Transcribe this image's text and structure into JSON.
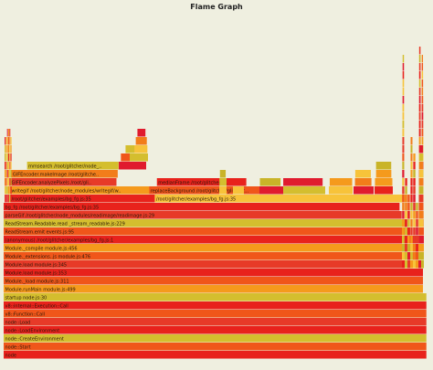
{
  "title": "Flame Graph",
  "colors": {
    "background": "#efefe0",
    "palette": [
      "#e8221c",
      "#f0561a",
      "#f59a1c",
      "#f7c33a",
      "#d4be2e",
      "#e73a28",
      "#c9b428",
      "#f27d1a",
      "#e01b2e"
    ]
  },
  "chart_data": {
    "type": "flame",
    "title": "Flame Graph",
    "frames": [
      {
        "name": "node",
        "depth": 0,
        "start": 0.0,
        "width": 99.3,
        "c": 0
      },
      {
        "name": "node::Start",
        "depth": 1,
        "start": 0.0,
        "width": 99.3,
        "c": 1
      },
      {
        "name": "node::CreateEnvironment",
        "depth": 2,
        "start": 0.0,
        "width": 99.3,
        "c": 4
      },
      {
        "name": "node::LoadEnvironment",
        "depth": 3,
        "start": 0.0,
        "width": 99.3,
        "c": 0
      },
      {
        "name": "node::Load",
        "depth": 4,
        "start": 0.0,
        "width": 99.3,
        "c": 5
      },
      {
        "name": "v8::Function::Call",
        "depth": 5,
        "start": 0.0,
        "width": 99.3,
        "c": 1
      },
      {
        "name": "v8::internal::Execution::Call",
        "depth": 6,
        "start": 0.0,
        "width": 99.3,
        "c": 0
      },
      {
        "name": "startup node.js:30",
        "depth": 7,
        "start": 0.0,
        "width": 99.3,
        "c": 4
      },
      {
        "name": "Module.runMain module.js:499",
        "depth": 8,
        "start": 0.0,
        "width": 98.5,
        "c": 2
      },
      {
        "name": "Module._load module.js:311",
        "depth": 9,
        "start": 0.0,
        "width": 98.5,
        "c": 1
      },
      {
        "name": "Module.load module.js:353",
        "depth": 10,
        "start": 0.0,
        "width": 98.5,
        "c": 0
      },
      {
        "name": "Module.load module.js:345",
        "depth": 11,
        "start": 0.0,
        "width": 98.5,
        "c": 5
      },
      {
        "name": "Module._extensions..js module.js:476",
        "depth": 12,
        "start": 0.0,
        "width": 98.5,
        "c": 1
      },
      {
        "name": "Module._compile module.js:456",
        "depth": 13,
        "start": 0.0,
        "width": 98.0,
        "c": 2
      },
      {
        "name": "(anonymous) /root/glitcher/examples/bg_fg.js:1",
        "depth": 14,
        "start": 0.0,
        "width": 97.5,
        "c": 0
      },
      {
        "name": "ReadStream.emit events.js:95",
        "depth": 15,
        "start": 0.0,
        "width": 95.5,
        "c": 1
      },
      {
        "name": "ReadStream.Readable.read _stream_readable.js:229",
        "depth": 16,
        "start": 0.0,
        "width": 94.5,
        "c": 4
      },
      {
        "name": "parseGif /root/glitcher/node_modules/readimage/readimage.js:29",
        "depth": 17,
        "start": 0.0,
        "width": 93.5,
        "c": 5
      },
      {
        "name": "bg_fg /root/glitcher/examples/bg_fg.js:35",
        "depth": 18,
        "start": 0.0,
        "width": 93.0,
        "c": 0
      },
      {
        "name": "/root/glitcher/examples/bg_fg.js:35",
        "depth": 19,
        "start": 1.5,
        "width": 34.0,
        "c": 0
      },
      {
        "name": "/root/glitcher/examples/bg_fg.js:35",
        "depth": 19,
        "start": 35.5,
        "width": 59.0,
        "c": 3
      },
      {
        "name": "writegif /root/glitcher/node_modules/writegif/writegif.js:3",
        "depth": 20,
        "start": 1.5,
        "width": 33.5,
        "c": 2
      },
      {
        "name": "GIFEncoder.analyzePixels /root/glitcher/node_mo...",
        "depth": 21,
        "start": 1.5,
        "width": 25.0,
        "c": 5
      },
      {
        "name": "GIFEncoder.makeImage /root/glitcher/node_modu...",
        "depth": 22,
        "start": 1.8,
        "width": 25.0,
        "c": 7
      },
      {
        "name": "mmsearch /root/glitcher/node_mo...",
        "depth": 23,
        "start": 5.5,
        "width": 21.5,
        "c": 4
      },
      {
        "name": "avg /root/glitcher/glitcher.js:321",
        "depth": 20,
        "start": 36.5,
        "width": 20.5,
        "c": 8
      },
      {
        "name": "medianFrame /root/glitcher/glitcher.js:312",
        "depth": 21,
        "start": 36.0,
        "width": 21.0,
        "c": 0
      },
      {
        "name": "replaceBackground /root/glitcher/glitcher.js:697",
        "depth": 20,
        "start": 34.2,
        "width": 30.0,
        "c": 1
      }
    ]
  }
}
